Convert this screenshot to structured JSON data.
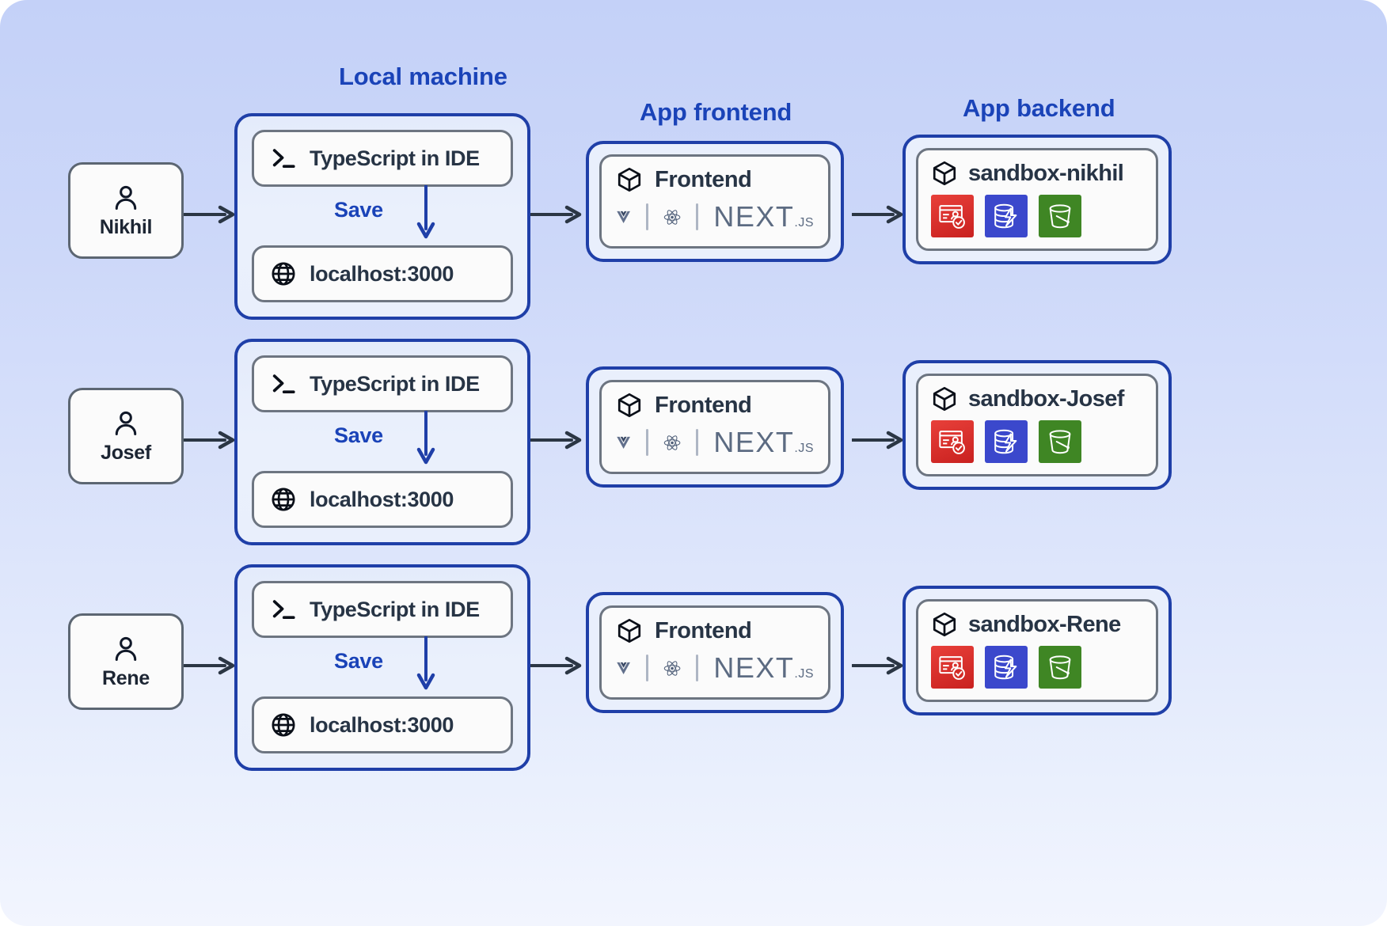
{
  "headings": {
    "local": "Local machine",
    "frontend": "App frontend",
    "backend": "App backend"
  },
  "labels": {
    "ide": "TypeScript in IDE",
    "save": "Save",
    "localhost": "localhost:3000",
    "frontend": "Frontend",
    "next_wordmark": "NEXT",
    "next_suffix": ".JS"
  },
  "icons": {
    "person": "person-icon",
    "terminal": "terminal-prompt-icon",
    "globe": "globe-icon",
    "cube": "cube-icon",
    "vue": "vue-logo",
    "react": "react-logo",
    "nextjs": "nextjs-logo",
    "cognito": "aws-cognito-icon",
    "dynamodb": "aws-dynamodb-icon",
    "s3": "aws-s3-icon",
    "arrow": "arrow-right-icon",
    "save_arrow": "arrow-down-icon"
  },
  "colors": {
    "accent_blue": "#1a43b8",
    "border_blue": "#1f3fa8",
    "border_gray": "#6d7581",
    "text_dark": "#273445",
    "cognito_red": "#dd3a34",
    "dynamodb_blue": "#3b48cc",
    "s3_green": "#3f8624",
    "bg_top": "#c4d1f8",
    "bg_bottom": "#f2f5fe"
  },
  "rows": [
    {
      "person": "Nikhil",
      "ide": "TypeScript in IDE",
      "save": "Save",
      "localhost": "localhost:3000",
      "frontend": "Frontend",
      "sandbox": "sandbox-nikhil"
    },
    {
      "person": "Josef",
      "ide": "TypeScript in IDE",
      "save": "Save",
      "localhost": "localhost:3000",
      "frontend": "Frontend",
      "sandbox": "sandbox-Josef"
    },
    {
      "person": "Rene",
      "ide": "TypeScript in IDE",
      "save": "Save",
      "localhost": "localhost:3000",
      "frontend": "Frontend",
      "sandbox": "sandbox-Rene"
    }
  ],
  "services": [
    {
      "name": "aws-cognito-icon",
      "color": "#dd3a34"
    },
    {
      "name": "aws-dynamodb-icon",
      "color": "#3b48cc"
    },
    {
      "name": "aws-s3-icon",
      "color": "#3f8624"
    }
  ]
}
